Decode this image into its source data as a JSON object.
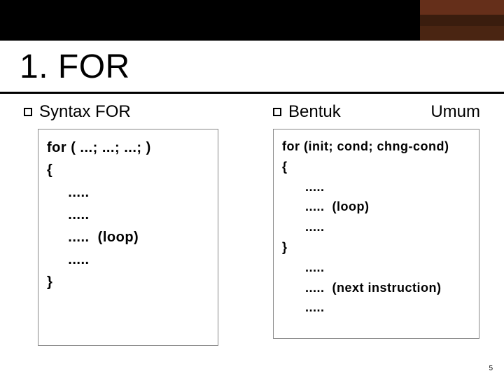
{
  "slide": {
    "title": "1. FOR",
    "page_number": "5"
  },
  "left": {
    "heading": "Syntax FOR",
    "code": "for ( ...; ...; ...; )\n{\n     .....\n     .....\n     .....  (loop)\n     .....\n}"
  },
  "right": {
    "heading_a": "Bentuk",
    "heading_b": "Umum",
    "code": "for (init; cond; chng-cond)\n{\n      .....\n      .....  (loop)\n      .....\n}\n      .....\n      .....  (next instruction)\n      ....."
  }
}
